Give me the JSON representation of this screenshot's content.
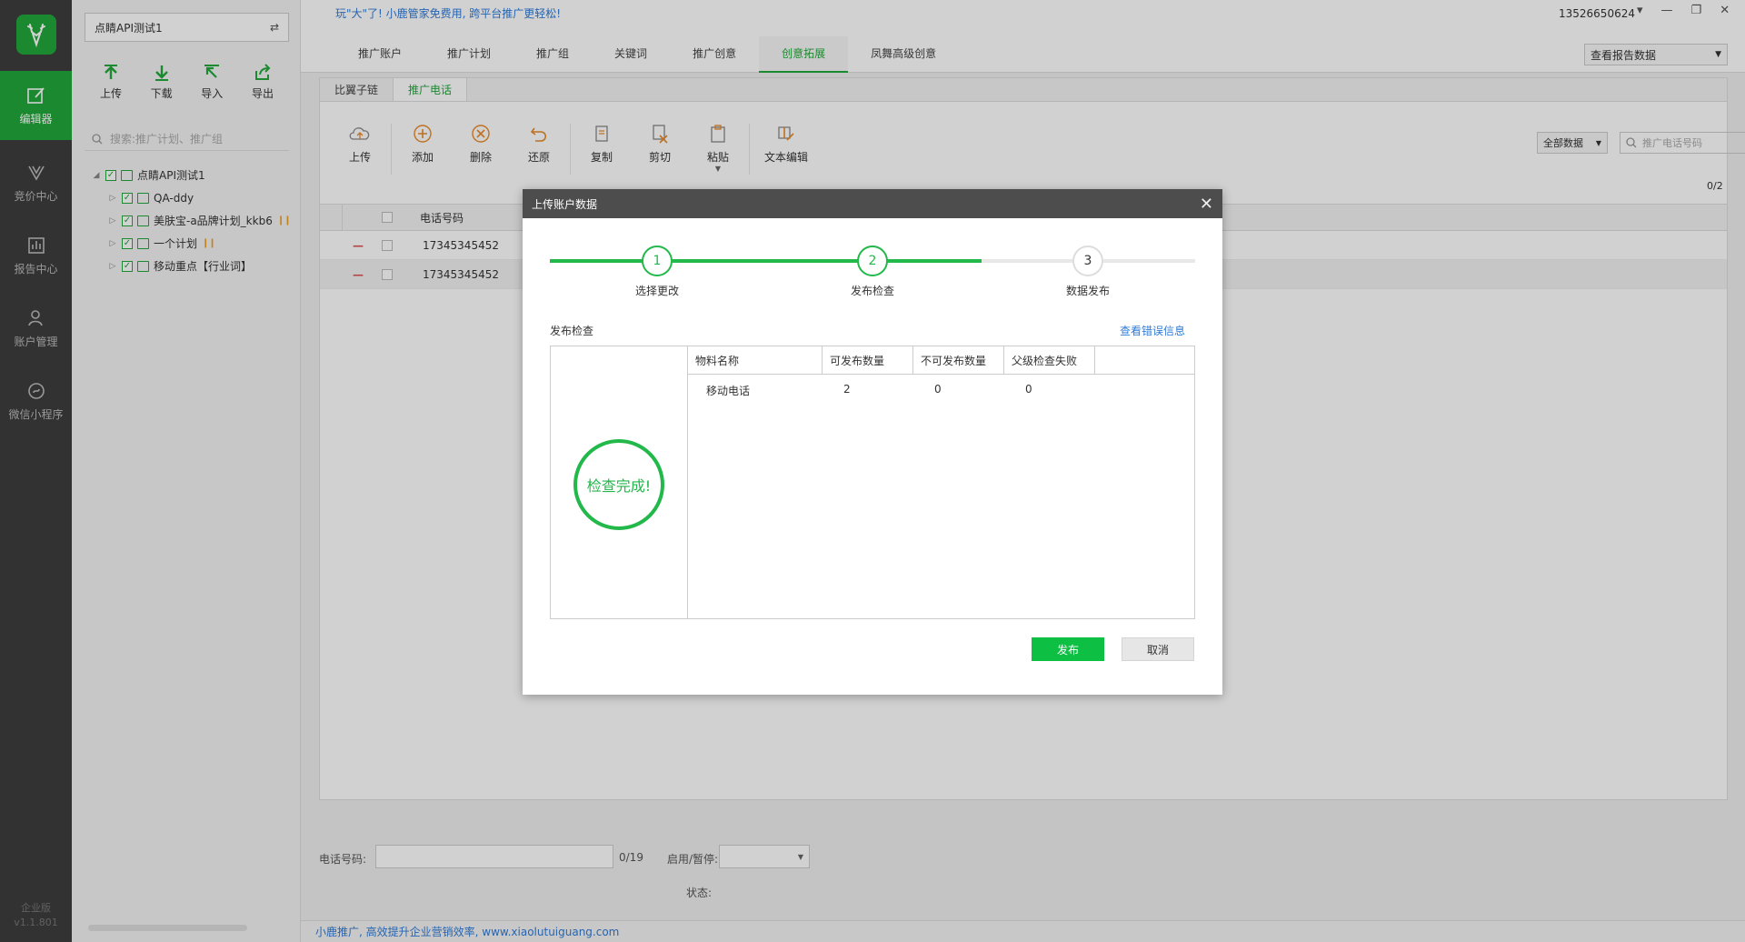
{
  "rail": {
    "items": [
      {
        "label": "编辑器",
        "icon": "edit-icon",
        "active": true
      },
      {
        "label": "竞价中心",
        "icon": "bid-icon"
      },
      {
        "label": "报告中心",
        "icon": "report-icon"
      },
      {
        "label": "账户管理",
        "icon": "user-icon"
      },
      {
        "label": "微信小程序",
        "icon": "wechat-mini-icon"
      }
    ],
    "edition": "企业版",
    "version": "v1.1.801"
  },
  "pane": {
    "account": "点睛API测试1",
    "tools": [
      {
        "label": "上传",
        "icon": "upload-icon"
      },
      {
        "label": "下载",
        "icon": "download-icon"
      },
      {
        "label": "导入",
        "icon": "import-icon"
      },
      {
        "label": "导出",
        "icon": "export-icon"
      }
    ],
    "search_placeholder": "搜索:推广计划、推广组",
    "tree": [
      {
        "label": "点睛API测试1",
        "level": 0,
        "expanded": true
      },
      {
        "label": "QA-ddy",
        "level": 1
      },
      {
        "label": "美肤宝-a品牌计划_kkb6",
        "level": 1,
        "paused": true
      },
      {
        "label": "一个计划",
        "level": 1,
        "paused": true
      },
      {
        "label": "移动重点【行业词】",
        "level": 1
      }
    ]
  },
  "top": {
    "promo": "玩\"大\"了! 小鹿管家免费用, 跨平台推广更轻松!",
    "tabs": [
      "推广账户",
      "推广计划",
      "推广组",
      "关键词",
      "推广创意",
      "创意拓展",
      "凤舞高级创意"
    ],
    "active_tab": 5,
    "phone": "13526650624",
    "report_select": "查看报告数据"
  },
  "sub": {
    "tabs": [
      "比翼子链",
      "推广电话"
    ],
    "active_tab": 1,
    "ops": [
      {
        "label": "上传",
        "icon": "cloud-upload-icon"
      },
      {
        "label": "添加",
        "icon": "add-icon"
      },
      {
        "label": "删除",
        "icon": "delete-icon"
      },
      {
        "label": "还原",
        "icon": "undo-icon"
      },
      {
        "label": "复制",
        "icon": "copy-icon"
      },
      {
        "label": "剪切",
        "icon": "cut-icon"
      },
      {
        "label": "粘贴",
        "icon": "paste-icon"
      },
      {
        "label": "文本编辑",
        "icon": "text-edit-icon"
      }
    ],
    "filter": "全部数据",
    "search_placeholder": "推广电话号码",
    "count": "0/2",
    "col_phone": "电话号码",
    "rows": [
      "17345345452",
      "17345345452"
    ]
  },
  "bottom": {
    "phone_label": "电话号码:",
    "phone_count": "0/19",
    "status_toggle_label": "启用/暂停:",
    "status_label": "状态:"
  },
  "footer": "小鹿推广, 高效提升企业营销效率, www.xiaolutuiguang.com",
  "modal": {
    "title": "上传账户数据",
    "steps": [
      {
        "num": "1",
        "label": "选择更改"
      },
      {
        "num": "2",
        "label": "发布检查"
      },
      {
        "num": "3",
        "label": "数据发布"
      }
    ],
    "current_step": 2,
    "section_title": "发布检查",
    "error_link": "查看错误信息",
    "status_text": "检查完成!",
    "columns": [
      "物料名称",
      "可发布数量",
      "不可发布数量",
      "父级检查失败"
    ],
    "rows": [
      {
        "name": "移动电话",
        "publishable": "2",
        "unpublishable": "0",
        "parent_failed": "0"
      }
    ],
    "publish_button": "发布",
    "cancel_button": "取消"
  },
  "colors": {
    "accent": "#22a83a",
    "link": "#2f7bd8",
    "rail": "#3d3d3d"
  }
}
